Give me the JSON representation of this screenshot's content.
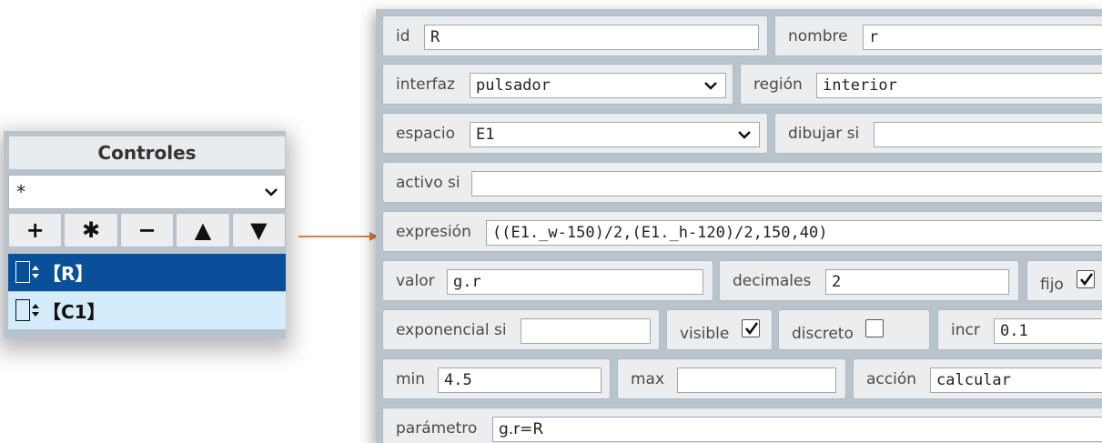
{
  "controls_panel": {
    "title": "Controles",
    "filter_value": "*",
    "buttons": [
      {
        "label": "+",
        "icon": "plus-icon"
      },
      {
        "label": "✱",
        "icon": "asterisk-icon"
      },
      {
        "label": "−",
        "icon": "minus-icon"
      },
      {
        "label": "▲",
        "icon": "up-arrow-icon"
      },
      {
        "label": "▼",
        "icon": "down-arrow-icon"
      }
    ],
    "items": [
      {
        "label": "【R】",
        "selected": true
      },
      {
        "label": "【C1】",
        "selected": false
      }
    ],
    "colors": {
      "selected_bg": "#0a4f9a",
      "item_bg": "#d4ecf9"
    }
  },
  "arrow_color": "#e07b39",
  "properties": {
    "id": {
      "label": "id",
      "value": "R"
    },
    "nombre": {
      "label": "nombre",
      "value": "r"
    },
    "interfaz": {
      "label": "interfaz",
      "value": "pulsador"
    },
    "region": {
      "label": "región",
      "value": "interior"
    },
    "espacio": {
      "label": "espacio",
      "value": "E1"
    },
    "dibujar_si": {
      "label": "dibujar si",
      "value": ""
    },
    "activo_si": {
      "label": "activo si",
      "value": ""
    },
    "expresion": {
      "label": "expresión",
      "value": "((E1._w-150)/2,(E1._h-120)/2,150,40)"
    },
    "valor": {
      "label": "valor",
      "value": "g.r"
    },
    "decimales": {
      "label": "decimales",
      "value": "2"
    },
    "fijo": {
      "label": "fijo",
      "checked": true
    },
    "exponencial_si": {
      "label": "exponencial si",
      "value": ""
    },
    "visible": {
      "label": "visible",
      "checked": true
    },
    "discreto": {
      "label": "discreto",
      "checked": false
    },
    "incr": {
      "label": "incr",
      "value": "0.1"
    },
    "min": {
      "label": "min",
      "value": "4.5"
    },
    "max": {
      "label": "max",
      "value": ""
    },
    "accion": {
      "label": "acción",
      "value": "calcular"
    },
    "parametro": {
      "label": "parámetro",
      "value": "g.r=R"
    }
  }
}
